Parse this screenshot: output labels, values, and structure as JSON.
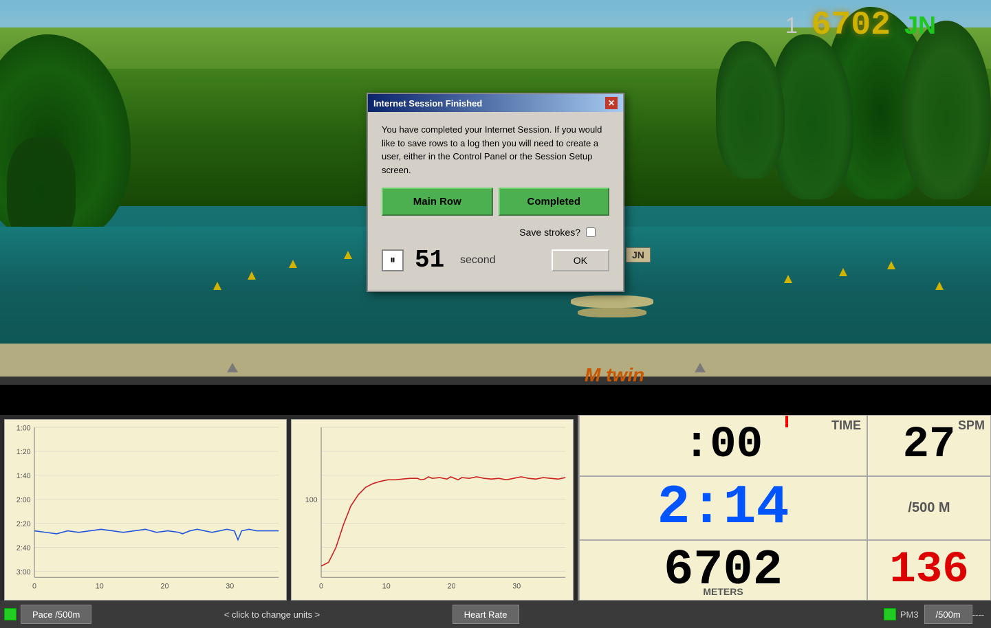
{
  "game": {
    "hud": {
      "position": "1",
      "distance": "6702",
      "tag": "JN"
    },
    "m_twin_label": "M twin",
    "jn_label": "JN"
  },
  "dialog": {
    "title": "Internet Session Finished",
    "close_btn": "✕",
    "message": "You have completed your Internet Session.  If you would like to save rows to a log then you will need to create a user, either in the Control Panel or the Session Setup screen.",
    "btn_main_row": "Main Row",
    "btn_completed": "Completed",
    "save_strokes_label": "Save strokes?",
    "counter": "51",
    "counter_unit": "second",
    "ok_btn": "OK"
  },
  "stats": {
    "time_value": ":00",
    "time_label": "TIME",
    "spm_value": "27",
    "spm_label": "SPM",
    "pace_value": "2:14",
    "pace_unit": "/500 M",
    "meters_value": "6702",
    "meters_label": "METERS",
    "heart_value": "136"
  },
  "bottom_bar": {
    "pace_btn": "Pace /500m",
    "click_text": "< click to change units >",
    "heart_btn": "Heart Rate",
    "pm3_label": "PM3",
    "slash500_btn": "/500m",
    "dashes": "----"
  },
  "graphs": {
    "pace_y_labels": [
      "1:00",
      "1:20",
      "1:40",
      "2:00",
      "2:20",
      "2:40",
      "3:00"
    ],
    "hr_y_labels": [
      "100"
    ],
    "x_labels": [
      "0",
      "10",
      "20",
      "30"
    ]
  }
}
